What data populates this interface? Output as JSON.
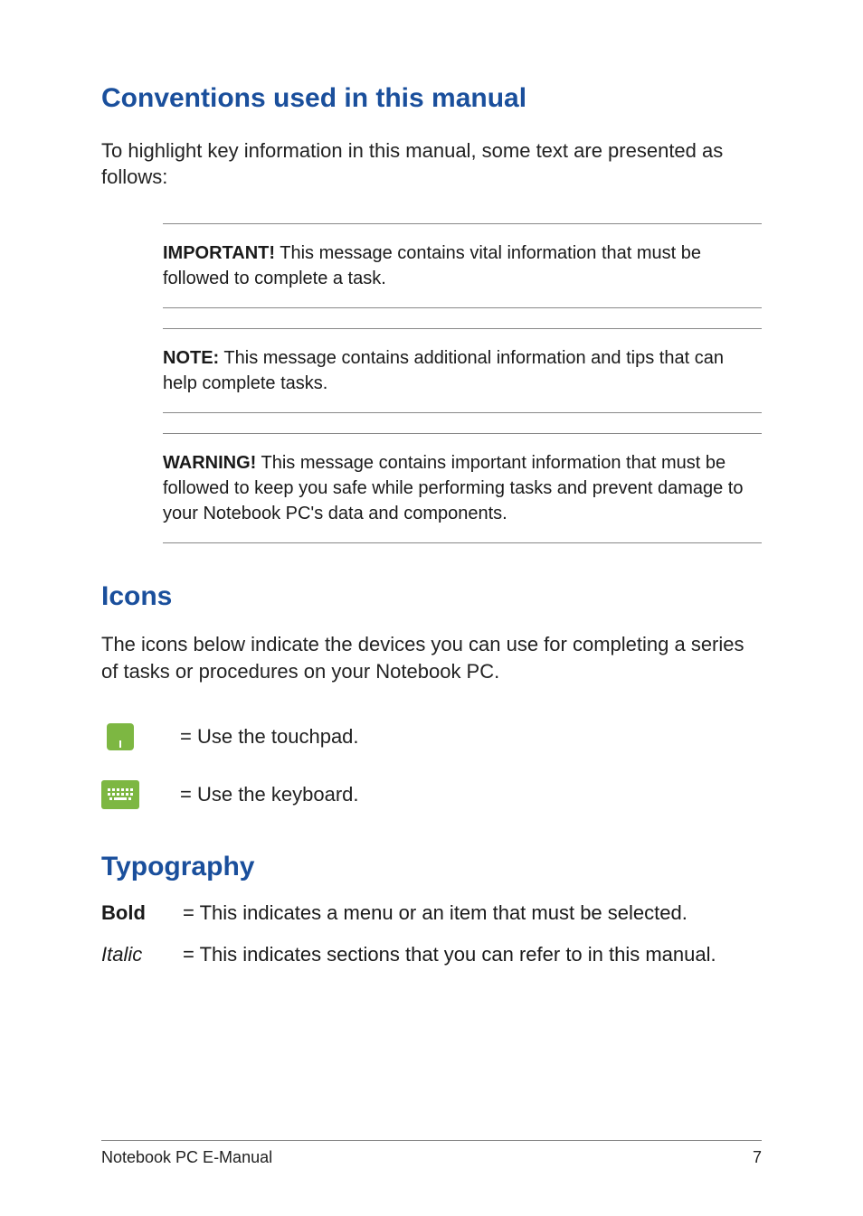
{
  "heading1": "Conventions used in this manual",
  "intro": "To highlight key information in this manual, some text are presented as follows:",
  "callouts": {
    "important": {
      "label": "IMPORTANT!",
      "text": " This message contains vital information that must be followed to complete a task."
    },
    "note": {
      "label": "NOTE:",
      "text": " This message contains additional information and tips that can help complete tasks."
    },
    "warning": {
      "label": "WARNING!",
      "text": " This message contains important information that must be followed to keep you safe while performing tasks and prevent damage to your Notebook PC's data and components."
    }
  },
  "heading_icons": "Icons",
  "icons_intro": "The icons below indicate the devices you can use for completing a series of tasks or procedures on your Notebook PC.",
  "icons": {
    "touchpad": "= Use the touchpad.",
    "keyboard": "= Use the keyboard."
  },
  "heading_typo": "Typography",
  "typography": {
    "bold": {
      "label": "Bold",
      "desc": "= This indicates a menu or an item that must be selected."
    },
    "italic": {
      "label": "Italic",
      "desc": "= This indicates sections that you can refer to in this manual."
    }
  },
  "footer": {
    "title": "Notebook PC E-Manual",
    "page": "7"
  }
}
